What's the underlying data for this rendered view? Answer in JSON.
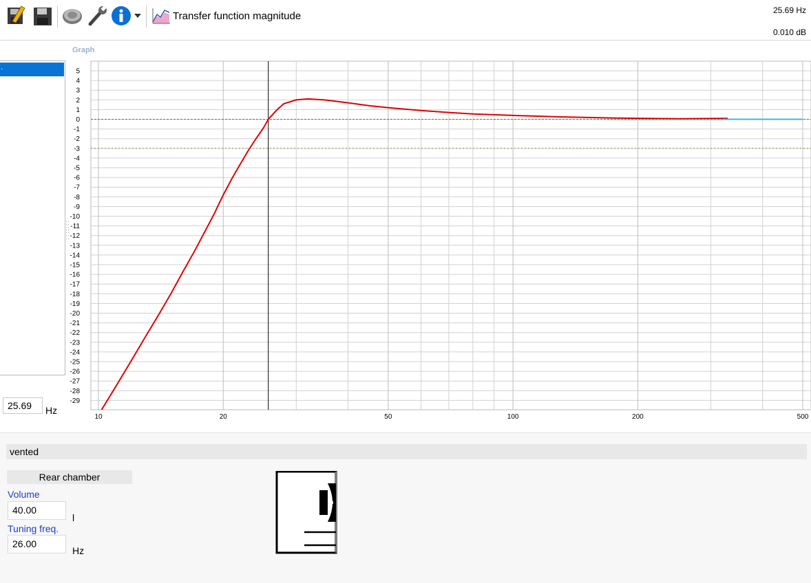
{
  "toolbar": {
    "icons": [
      "edit-icon",
      "save-icon",
      "speaker-icon",
      "wrench-icon",
      "info-icon",
      "dropdown-arrow-icon",
      "graph-icon"
    ],
    "title": "Transfer function magnitude"
  },
  "readout": {
    "frequency": "25.69 Hz",
    "level": "0.010 dB"
  },
  "graph_panel": {
    "label": "Graph"
  },
  "left_panel": {
    "selected_item": "."
  },
  "cursor_freq": {
    "value": "25.69",
    "unit": "Hz"
  },
  "chart_data": {
    "type": "line",
    "x_scale": "log",
    "xlim": [
      10,
      500
    ],
    "ylim": [
      -29,
      5
    ],
    "x_ticks": [
      {
        "v": 10,
        "label": "10"
      },
      {
        "v": 20,
        "label": "20"
      },
      {
        "v": 50,
        "label": "50"
      },
      {
        "v": 100,
        "label": "100"
      },
      {
        "v": 200,
        "label": "200"
      },
      {
        "v": 500,
        "label": "500"
      }
    ],
    "y_ticks": [
      5,
      4,
      3,
      2,
      1,
      0,
      -1,
      -2,
      -3,
      -4,
      -5,
      -6,
      -7,
      -8,
      -9,
      -10,
      -11,
      -12,
      -13,
      -14,
      -15,
      -16,
      -17,
      -18,
      -19,
      -20,
      -21,
      -22,
      -23,
      -24,
      -25,
      -26,
      -27,
      -28,
      -29
    ],
    "reference_lines": [
      0,
      -3
    ],
    "cursor_x": 25.69,
    "series": [
      {
        "color": "#e00000",
        "x": [
          10,
          11,
          12,
          13,
          14,
          15,
          16,
          17,
          18,
          19,
          20,
          21,
          22,
          23,
          24,
          25,
          25.69,
          27,
          28,
          30,
          32,
          35,
          40,
          45,
          50,
          60,
          70,
          80,
          100,
          130,
          180,
          250,
          330
        ],
        "y": [
          -30.5,
          -27.6,
          -24.9,
          -22.4,
          -20.1,
          -17.9,
          -15.7,
          -13.7,
          -11.7,
          -9.8,
          -7.8,
          -6.1,
          -4.6,
          -3.2,
          -2.0,
          -0.9,
          0.0,
          1.0,
          1.6,
          2.0,
          2.1,
          2.0,
          1.7,
          1.4,
          1.2,
          0.9,
          0.7,
          0.55,
          0.4,
          0.25,
          0.12,
          0.05,
          0.1
        ]
      },
      {
        "color": "#3cb4e6",
        "x": [
          320,
          500
        ],
        "y": [
          0.0,
          0.0
        ]
      }
    ]
  },
  "box": {
    "type": "vented"
  },
  "rear_chamber": {
    "title": "Rear chamber",
    "volume_label": "Volume",
    "volume_value": "40.00",
    "volume_unit": "l",
    "tuning_label": "Tuning freq.",
    "tuning_value": "26.00",
    "tuning_unit": "Hz"
  }
}
